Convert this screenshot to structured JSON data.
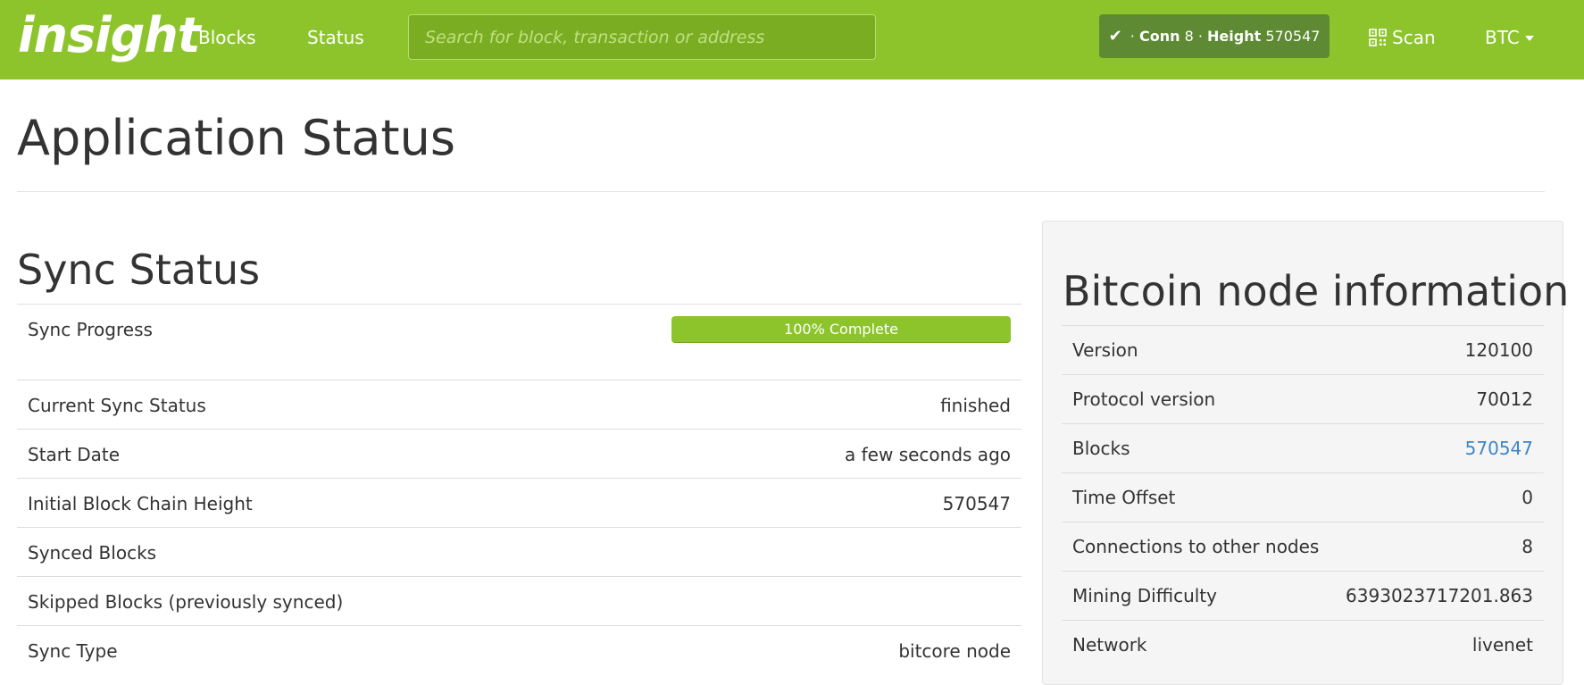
{
  "navbar": {
    "brand": "insight",
    "links": {
      "blocks": "Blocks",
      "status": "Status"
    },
    "search_placeholder": "Search for block, transaction or address",
    "conn_badge": {
      "conn_label": "Conn",
      "conn_value": "8",
      "height_label": "Height",
      "height_value": "570547"
    },
    "scan_label": "Scan",
    "currency": "BTC",
    "colors": {
      "bar": "#8dc42c",
      "badge": "#5e8a34"
    }
  },
  "page": {
    "title": "Application Status"
  },
  "sync": {
    "title": "Sync Status",
    "progress_label": "Sync Progress",
    "progress_percent": 100,
    "progress_text": "100% Complete",
    "rows": [
      {
        "label": "Current Sync Status",
        "value": "finished"
      },
      {
        "label": "Start Date",
        "value": "a few seconds ago"
      },
      {
        "label": "Initial Block Chain Height",
        "value": "570547"
      },
      {
        "label": "Synced Blocks",
        "value": ""
      },
      {
        "label": "Skipped Blocks (previously synced)",
        "value": ""
      },
      {
        "label": "Sync Type",
        "value": "bitcore node"
      }
    ]
  },
  "node": {
    "title": "Bitcoin node information",
    "rows": [
      {
        "label": "Version",
        "value": "120100"
      },
      {
        "label": "Protocol version",
        "value": "70012"
      },
      {
        "label": "Blocks",
        "value": "570547"
      },
      {
        "label": "Time Offset",
        "value": "0"
      },
      {
        "label": "Connections to other nodes",
        "value": "8"
      },
      {
        "label": "Mining Difficulty",
        "value": "6393023717201.863"
      },
      {
        "label": "Network",
        "value": "livenet"
      }
    ]
  }
}
